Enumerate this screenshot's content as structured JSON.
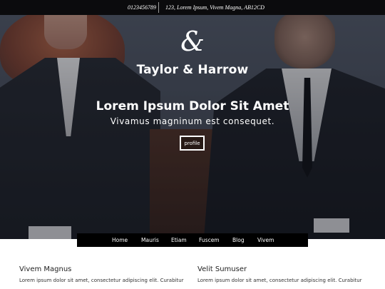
{
  "topbar": {
    "phone": "0123456789",
    "address": "123, Lorem Ipsum,  Vivem Magna,  AB12CD"
  },
  "hero": {
    "logo_mark": "&",
    "brand": "Taylor & Harrow",
    "headline": "Lorem Ipsum Dolor Sit Amet",
    "subheadline": "Vivamus magninum est consequet.",
    "button_label": "profile"
  },
  "nav": {
    "items": [
      "Home",
      "Mauris",
      "Etiam",
      "Fuscem",
      "Blog",
      "Vivem"
    ]
  },
  "columns": [
    {
      "title": "Vivem Magnus",
      "text": "Lorem ipsum dolor sit amet, consectetur adipiscing elit. Curabitur"
    },
    {
      "title": "Velit Sumuser",
      "text": "Lorem ipsum dolor sit amet, consectetur adipiscing elit. Curabitur"
    }
  ]
}
